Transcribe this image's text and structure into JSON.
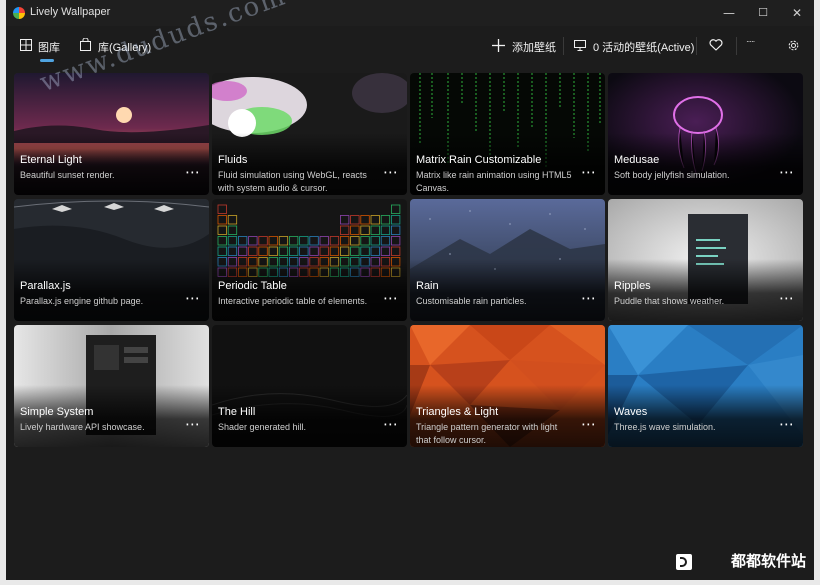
{
  "window": {
    "title": "Lively Wallpaper",
    "controls": {
      "minimize": "—",
      "maximize": "☐",
      "close": "✕"
    }
  },
  "tabs": [
    {
      "label": "图库",
      "icon": "grid-icon",
      "active": true
    },
    {
      "label": "库(Gallery)",
      "icon": "bag-icon",
      "active": false
    }
  ],
  "toolbar": {
    "add_label": "添加壁纸",
    "active_label": "0 活动的壁纸(Active)",
    "more_label": "·····"
  },
  "cards": [
    {
      "title": "Eternal Light",
      "desc": "Beautiful sunset render.",
      "more": "⋯"
    },
    {
      "title": "Fluids",
      "desc": "Fluid simulation using WebGL, reacts with system audio & cursor.",
      "more": "⋯"
    },
    {
      "title": "Matrix Rain Customizable",
      "desc": "Matrix like rain animation using HTML5 Canvas.",
      "more": "⋯"
    },
    {
      "title": "Medusae",
      "desc": "Soft body jellyfish simulation.",
      "more": "⋯"
    },
    {
      "title": "Parallax.js",
      "desc": "Parallax.js engine github page.",
      "more": "⋯"
    },
    {
      "title": "Periodic Table",
      "desc": "Interactive periodic table of elements.",
      "more": "⋯"
    },
    {
      "title": "Rain",
      "desc": "Customisable rain particles.",
      "more": "⋯"
    },
    {
      "title": "Ripples",
      "desc": "Puddle that shows weather.",
      "more": "⋯"
    },
    {
      "title": "Simple System",
      "desc": "Lively hardware API showcase.",
      "more": "⋯"
    },
    {
      "title": "The Hill",
      "desc": "Shader generated hill.",
      "more": "⋯"
    },
    {
      "title": "Triangles & Light",
      "desc": "Triangle pattern generator with light that follow cursor.",
      "more": "⋯"
    },
    {
      "title": "Waves",
      "desc": "Three.js wave simulation.",
      "more": "⋯"
    }
  ],
  "watermark": {
    "url": "www.dududs.com",
    "site": "都都软件站"
  },
  "colors": {
    "accent": "#4fa3e0",
    "background": "#1c1c1c"
  }
}
